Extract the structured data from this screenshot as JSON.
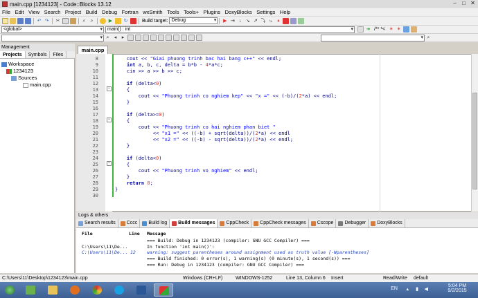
{
  "window": {
    "title": "main.cpp [1234123] - Code::Blocks 13.12"
  },
  "menu": [
    "File",
    "Edit",
    "View",
    "Search",
    "Project",
    "Build",
    "Debug",
    "Fortran",
    "wxSmith",
    "Tools",
    "Tools+",
    "Plugins",
    "DoxyBlocks",
    "Settings",
    "Help"
  ],
  "toolbar": {
    "build_target": "Debug",
    "scope": "<global>",
    "function": "main() : int",
    "doc_comment": "/** *<"
  },
  "management": {
    "header": "Management",
    "tabs": [
      "Projects",
      "Symbols",
      "Files"
    ],
    "tree": {
      "workspace": "Workspace",
      "project": "1234123",
      "folder": "Sources",
      "file": "main.cpp"
    }
  },
  "editor": {
    "tab": "main.cpp",
    "lines": [
      {
        "n": "8",
        "code": "    cout << \"Giai phuong trinh bac hai bang c++\" << endl;"
      },
      {
        "n": "9",
        "code": "    int a, b, c, delta = b*b - 4*a*c;"
      },
      {
        "n": "10",
        "code": "    cin >> a >> b >> c;"
      },
      {
        "n": "11",
        "code": ""
      },
      {
        "n": "12",
        "code": "    if (delta<0)"
      },
      {
        "n": "13",
        "code": "    {"
      },
      {
        "n": "14",
        "code": "        cout << \"Phuong trinh co nghiem kep\" << \"x =\" << (-b)/(2*a) << endl;"
      },
      {
        "n": "15",
        "code": "    }"
      },
      {
        "n": "16",
        "code": ""
      },
      {
        "n": "17",
        "code": "    if (delta>=0)"
      },
      {
        "n": "18",
        "code": "    {"
      },
      {
        "n": "19",
        "code": "        cout << \"Phuong trinh co hai nghiem phan biet \""
      },
      {
        "n": "20",
        "code": "             << \"x1 =\" << ((-b) + sqrt(delta))/(2*a) << endl"
      },
      {
        "n": "21",
        "code": "             << \"x2 =\" << ((-b) - sqrt(delta))/(2*a) << endl;"
      },
      {
        "n": "22",
        "code": "    }"
      },
      {
        "n": "23",
        "code": ""
      },
      {
        "n": "24",
        "code": "    if (delta<0)"
      },
      {
        "n": "25",
        "code": "    {"
      },
      {
        "n": "26",
        "code": "        cout << \"Phuong trinh vo nghiem\" << endl;"
      },
      {
        "n": "27",
        "code": "    }"
      },
      {
        "n": "28",
        "code": "    return 0;"
      },
      {
        "n": "29",
        "code": "}"
      },
      {
        "n": "30",
        "code": ""
      }
    ]
  },
  "logs": {
    "header": "Logs & others",
    "tabs": [
      "Search results",
      "Cccc",
      "Build log",
      "Build messages",
      "CppCheck",
      "CppCheck messages",
      "Cscope",
      "Debugger",
      "DoxyBlocks"
    ],
    "columns": [
      "File",
      "Line",
      "Message"
    ],
    "rows": [
      {
        "file": "",
        "line": "",
        "message": "=== Build: Debug in 1234123 (compiler: GNU GCC Compiler) ==="
      },
      {
        "file": "C:\\Users\\11\\De...",
        "line": "",
        "message": "In function 'int main()':"
      },
      {
        "file": "C:\\Users\\11\\De...",
        "line": "12",
        "message": "warning: suggest parentheses around assignment used as truth value [-Wparentheses]"
      },
      {
        "file": "",
        "line": "",
        "message": "=== Build finished: 0 error(s), 1 warning(s) (0 minute(s), 1 second(s)) ==="
      },
      {
        "file": "",
        "line": "",
        "message": "=== Run: Debug in 1234123 (compiler: GNU GCC Compiler) ==="
      }
    ]
  },
  "status": {
    "path": "C:\\Users\\11\\Desktop\\1234123\\main.cpp",
    "eol": "Windows (CR+LF)",
    "encoding": "WINDOWS-1252",
    "position": "Line 13, Column 6",
    "mode": "Insert",
    "access": "Read/Write",
    "profile": "default"
  },
  "taskbar": {
    "lang": "EN",
    "time": "5:04 PM",
    "date": "9/2/2015"
  }
}
